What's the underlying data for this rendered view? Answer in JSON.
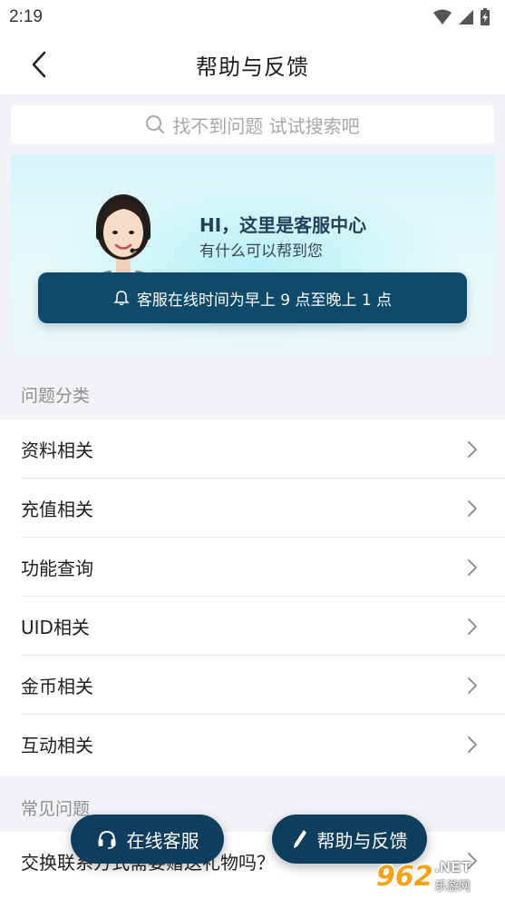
{
  "status_bar": {
    "time": "2:19"
  },
  "header": {
    "title": "帮助与反馈",
    "back_icon": "chevron-left-icon"
  },
  "search": {
    "placeholder": "找不到问题 试试搜索吧"
  },
  "banner": {
    "greeting": "HI，这里是客服中心",
    "subtitle": "有什么可以帮到您",
    "hours": "客服在线时间为早上 9 点至晚上 1 点"
  },
  "categories": {
    "title": "问题分类",
    "items": [
      {
        "label": "资料相关"
      },
      {
        "label": "充值相关"
      },
      {
        "label": "功能查询"
      },
      {
        "label": "UID相关"
      },
      {
        "label": "金币相关"
      },
      {
        "label": "互动相关"
      }
    ]
  },
  "faq": {
    "title": "常见问题",
    "items": [
      {
        "label": "交换联系方式需要赠送礼物吗？"
      }
    ]
  },
  "fab": {
    "service_label": "在线客服",
    "feedback_label": "帮助与反馈"
  },
  "watermark": {
    "number": "962",
    "domain": ".NET",
    "name": "乐游网"
  },
  "colors": {
    "accent": "#0f3d5e",
    "pill": "#0f4a6b",
    "watermark": "#f6a21a"
  }
}
